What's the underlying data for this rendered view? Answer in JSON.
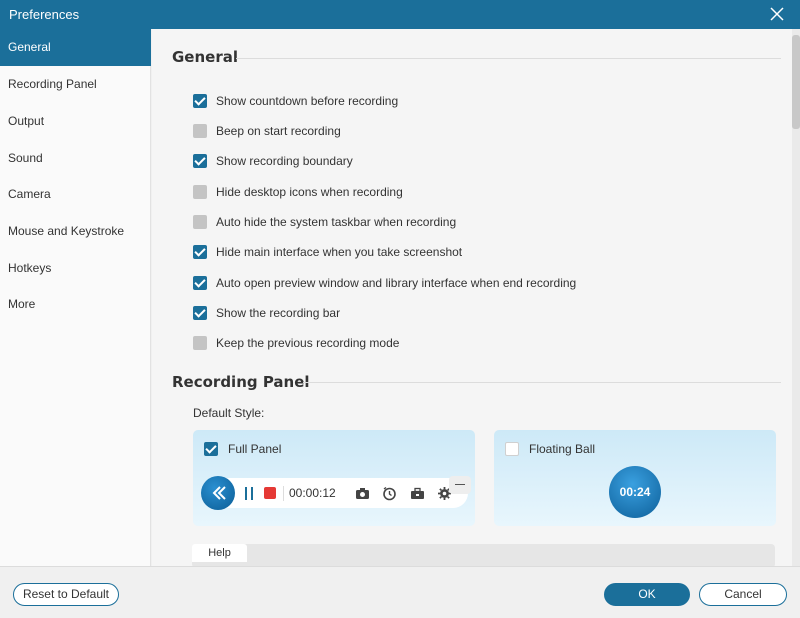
{
  "window": {
    "title": "Preferences"
  },
  "colors": {
    "accent": "#1b6f9a",
    "stop": "#e53935"
  },
  "sidebar": {
    "items": [
      {
        "label": "General",
        "active": true
      },
      {
        "label": "Recording Panel"
      },
      {
        "label": "Output"
      },
      {
        "label": "Sound"
      },
      {
        "label": "Camera"
      },
      {
        "label": "Mouse and Keystroke"
      },
      {
        "label": "Hotkeys"
      },
      {
        "label": "More"
      }
    ]
  },
  "general": {
    "title": "General",
    "options": [
      {
        "label": "Show countdown before recording",
        "checked": true
      },
      {
        "label": "Beep on start recording",
        "checked": false
      },
      {
        "label": "Show recording boundary",
        "checked": true
      },
      {
        "label": "Hide desktop icons when recording",
        "checked": false
      },
      {
        "label": "Auto hide the system taskbar when recording",
        "checked": false
      },
      {
        "label": "Hide main interface when you take screenshot",
        "checked": true
      },
      {
        "label": "Auto open preview window and library interface when end recording",
        "checked": true
      },
      {
        "label": "Show the recording bar",
        "checked": true
      },
      {
        "label": "Keep the previous recording mode",
        "checked": false
      }
    ]
  },
  "recording_panel": {
    "title": "Recording Panel",
    "default_style_label": "Default Style:",
    "full_panel": {
      "label": "Full Panel",
      "checked": true,
      "timer": "00:00:12"
    },
    "floating_ball": {
      "label": "Floating Ball",
      "checked": false,
      "timer": "00:24"
    },
    "help_tab": "Help"
  },
  "footer": {
    "reset_label": "Reset to Default",
    "ok_label": "OK",
    "cancel_label": "Cancel"
  }
}
